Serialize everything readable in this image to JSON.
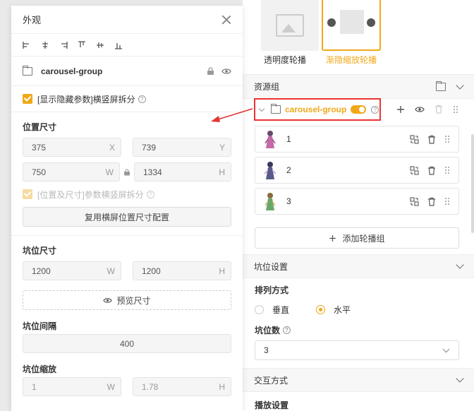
{
  "appearance_panel": {
    "title": "外观",
    "group_name": "carousel-group",
    "show_hidden_params_label": "[显示隐藏参数]横竖屏拆分",
    "position_size": {
      "title": "位置尺寸",
      "x": "375",
      "x_unit": "X",
      "y": "739",
      "y_unit": "Y",
      "w": "750",
      "w_unit": "W",
      "h": "1334",
      "h_unit": "H",
      "split_label": "[位置及尺寸]参数横竖屏拆分",
      "reuse_button": "复用横屏位置尺寸配置"
    },
    "slot_size": {
      "title": "坑位尺寸",
      "w": "1200",
      "w_unit": "W",
      "h": "1200",
      "h_unit": "H",
      "preview_button": "预览尺寸"
    },
    "slot_gap": {
      "title": "坑位间隔",
      "value": "400"
    },
    "slot_scale": {
      "title": "坑位缩放",
      "w": "1",
      "w_unit": "W",
      "h": "1.78",
      "h_unit": "H"
    }
  },
  "right_panel": {
    "templates": [
      {
        "label": "透明度轮播",
        "selected": false
      },
      {
        "label": "渐隐缩放轮播",
        "selected": true
      }
    ],
    "resource_group": {
      "title": "资源组",
      "group_name": "carousel-group",
      "items": [
        {
          "label": "1"
        },
        {
          "label": "2"
        },
        {
          "label": "3"
        }
      ],
      "add_button": "添加轮播组"
    },
    "slot_settings": {
      "title": "坑位设置",
      "arrange_title": "排列方式",
      "options": [
        {
          "label": "垂直",
          "selected": false
        },
        {
          "label": "水平",
          "selected": true
        }
      ],
      "count_title": "坑位数",
      "count_value": "3"
    },
    "interaction": {
      "title": "交互方式",
      "play_settings": "播放设置"
    }
  },
  "colors": {
    "accent": "#f0a818",
    "highlight": "#e33333"
  }
}
